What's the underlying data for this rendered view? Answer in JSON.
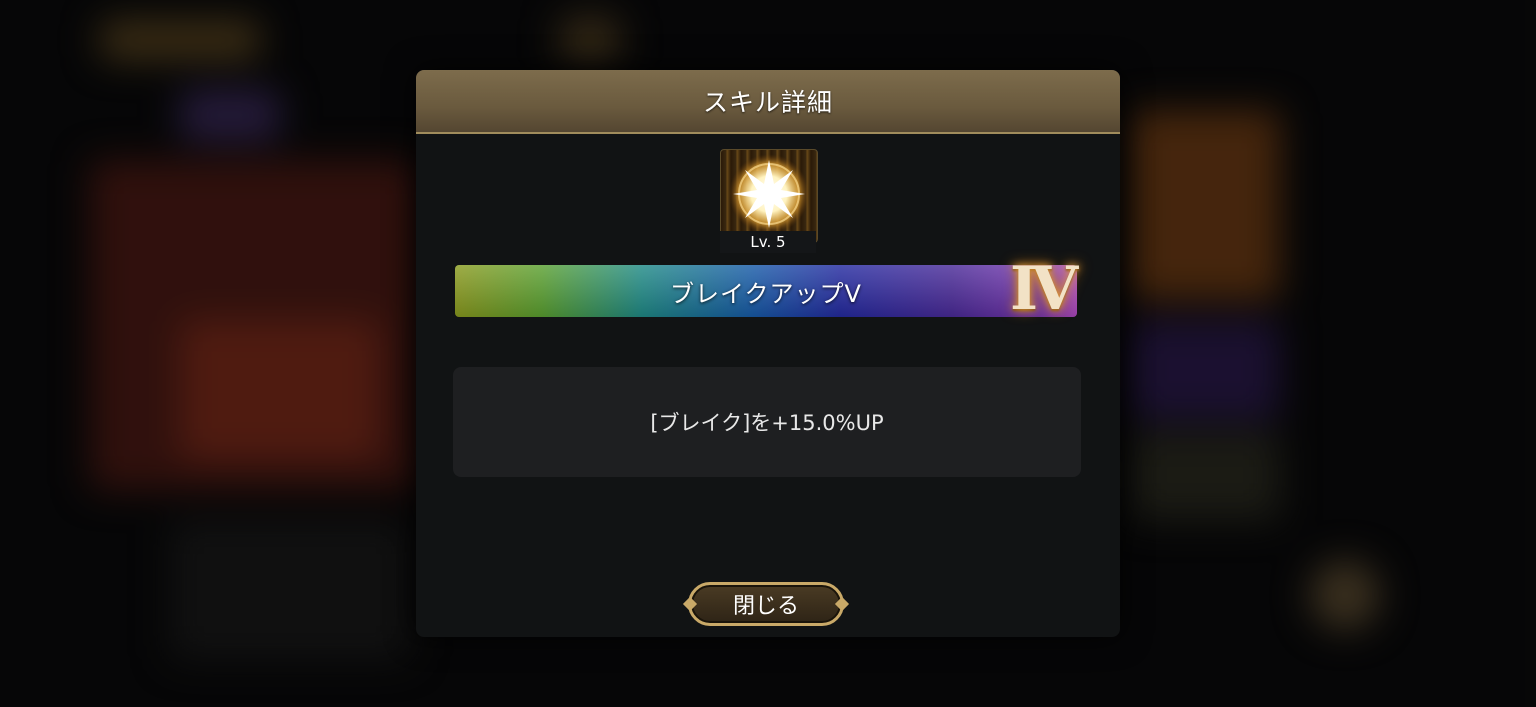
{
  "modal": {
    "title": "スキル詳細",
    "skill": {
      "icon": "sunburst-skill-icon",
      "level_label": "Lv. 5",
      "name": "ブレイクアップV",
      "rank_badge": "Ⅳ",
      "description": "[ブレイク]を+15.0%UP"
    },
    "close_label": "閉じる"
  },
  "colors": {
    "header": "#6a5a3e",
    "panel": "#111314",
    "button_border": "#c9a968"
  }
}
